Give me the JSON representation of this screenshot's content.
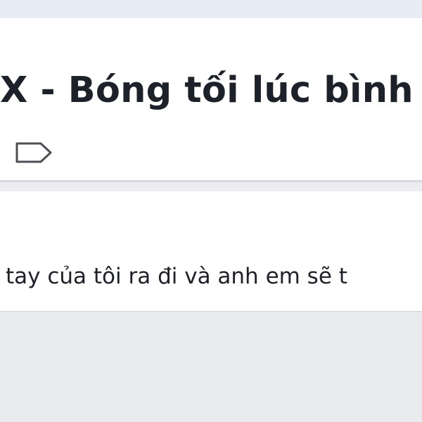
{
  "page": {
    "title": "X - Bóng tối lúc bình m",
    "post_text": "tay của tôi ra đi và anh em sẽ t",
    "tag_icon": "tag-icon"
  },
  "colors": {
    "background": "#e9ebee",
    "card": "#ffffff",
    "text": "#1d2129",
    "top_strip": "#e8edf5"
  }
}
